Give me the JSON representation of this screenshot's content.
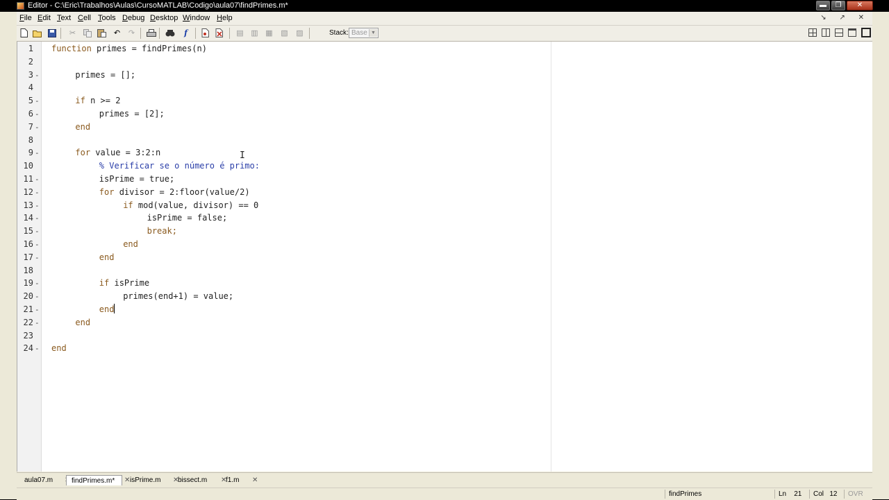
{
  "window": {
    "title": "Editor - C:\\Eric\\Trabalhos\\Aulas\\CursoMATLAB\\Codigo\\aula07\\findPrimes.m*",
    "controls": {
      "minimize": "▬",
      "maximize": "❐",
      "close": "✕"
    }
  },
  "menu": {
    "items": [
      {
        "key": "F",
        "rest": "ile"
      },
      {
        "key": "E",
        "rest": "dit"
      },
      {
        "key": "T",
        "rest": "ext"
      },
      {
        "key": "C",
        "rest": "ell"
      },
      {
        "key": "T",
        "rest": "ools"
      },
      {
        "key": "D",
        "rest": "ebug"
      },
      {
        "key": "D",
        "rest": "esktop"
      },
      {
        "key": "W",
        "rest": "indow"
      },
      {
        "key": "H",
        "rest": "elp"
      }
    ],
    "right_glyphs": "↘ ↗ ✕"
  },
  "toolbar": {
    "stack_label": "Stack:",
    "stack_value": "Base",
    "fx_label": "f",
    "icons": [
      "new-file-icon",
      "open-file-icon",
      "save-icon",
      "cut-icon",
      "copy-icon",
      "paste-icon",
      "undo-icon",
      "redo-icon",
      "print-icon",
      "find-icon",
      "function-icon",
      "set-breakpoint-icon",
      "clear-breakpoints-icon",
      "step-icon",
      "step-in-icon",
      "step-out-icon",
      "continue-icon",
      "exit-debug-icon",
      "tile-icon",
      "split-vertical-icon",
      "split-horizontal-icon",
      "float-icon",
      "dock-icon"
    ]
  },
  "colors": {
    "keyword": "#8a5a1e",
    "comment": "#2a3ea8",
    "text": "#222222"
  },
  "editor": {
    "lines": [
      {
        "n": "1",
        "dash": false,
        "indent": 0,
        "parts": [
          {
            "t": "function",
            "c": "kw"
          },
          {
            "t": " primes = findPrimes(n)",
            "c": "nm"
          }
        ]
      },
      {
        "n": "2",
        "dash": false,
        "indent": 0,
        "parts": []
      },
      {
        "n": "3",
        "dash": true,
        "indent": 1,
        "parts": [
          {
            "t": "primes = [];",
            "c": "nm"
          }
        ]
      },
      {
        "n": "4",
        "dash": false,
        "indent": 0,
        "parts": []
      },
      {
        "n": "5",
        "dash": true,
        "indent": 1,
        "parts": [
          {
            "t": "if",
            "c": "kw"
          },
          {
            "t": " n >= 2",
            "c": "nm"
          }
        ]
      },
      {
        "n": "6",
        "dash": true,
        "indent": 2,
        "parts": [
          {
            "t": "primes = [2];",
            "c": "nm"
          }
        ]
      },
      {
        "n": "7",
        "dash": true,
        "indent": 1,
        "parts": [
          {
            "t": "end",
            "c": "kw"
          }
        ]
      },
      {
        "n": "8",
        "dash": false,
        "indent": 0,
        "parts": []
      },
      {
        "n": "9",
        "dash": true,
        "indent": 1,
        "parts": [
          {
            "t": "for",
            "c": "kw"
          },
          {
            "t": " value = 3:2:n",
            "c": "nm"
          }
        ]
      },
      {
        "n": "10",
        "dash": false,
        "indent": 2,
        "parts": [
          {
            "t": "% Verificar se o número é primo:",
            "c": "cm"
          }
        ]
      },
      {
        "n": "11",
        "dash": true,
        "indent": 2,
        "parts": [
          {
            "t": "isPrime = true;",
            "c": "nm"
          }
        ]
      },
      {
        "n": "12",
        "dash": true,
        "indent": 2,
        "parts": [
          {
            "t": "for",
            "c": "kw"
          },
          {
            "t": " divisor = 2:floor(value/2)",
            "c": "nm"
          }
        ]
      },
      {
        "n": "13",
        "dash": true,
        "indent": 3,
        "parts": [
          {
            "t": "if",
            "c": "kw"
          },
          {
            "t": " mod(value, divisor) == 0",
            "c": "nm"
          }
        ]
      },
      {
        "n": "14",
        "dash": true,
        "indent": 4,
        "parts": [
          {
            "t": "isPrime = false;",
            "c": "nm"
          }
        ]
      },
      {
        "n": "15",
        "dash": true,
        "indent": 4,
        "parts": [
          {
            "t": "break;",
            "c": "kw"
          }
        ]
      },
      {
        "n": "16",
        "dash": true,
        "indent": 3,
        "parts": [
          {
            "t": "end",
            "c": "kw"
          }
        ]
      },
      {
        "n": "17",
        "dash": true,
        "indent": 2,
        "parts": [
          {
            "t": "end",
            "c": "kw"
          }
        ]
      },
      {
        "n": "18",
        "dash": false,
        "indent": 0,
        "parts": []
      },
      {
        "n": "19",
        "dash": true,
        "indent": 2,
        "parts": [
          {
            "t": "if",
            "c": "kw"
          },
          {
            "t": " isPrime",
            "c": "nm"
          }
        ]
      },
      {
        "n": "20",
        "dash": true,
        "indent": 3,
        "parts": [
          {
            "t": "primes(end+1) = value;",
            "c": "nm"
          }
        ]
      },
      {
        "n": "21",
        "dash": true,
        "indent": 2,
        "parts": [
          {
            "t": "end",
            "c": "kw"
          }
        ],
        "caret": true
      },
      {
        "n": "22",
        "dash": true,
        "indent": 1,
        "parts": [
          {
            "t": "end",
            "c": "kw"
          }
        ]
      },
      {
        "n": "23",
        "dash": false,
        "indent": 0,
        "parts": []
      },
      {
        "n": "24",
        "dash": true,
        "indent": 0,
        "parts": [
          {
            "t": "end",
            "c": "kw"
          }
        ]
      }
    ]
  },
  "tabs": [
    {
      "label": "aula07.m",
      "active": false
    },
    {
      "label": "findPrimes.m*",
      "active": true
    },
    {
      "label": "isPrime.m",
      "active": false
    },
    {
      "label": "bissect.m",
      "active": false
    },
    {
      "label": "f1.m",
      "active": false
    }
  ],
  "status": {
    "function_name": "findPrimes",
    "ln_label": "Ln",
    "ln_value": "21",
    "col_label": "Col",
    "col_value": "12",
    "ovr": "OVR"
  }
}
